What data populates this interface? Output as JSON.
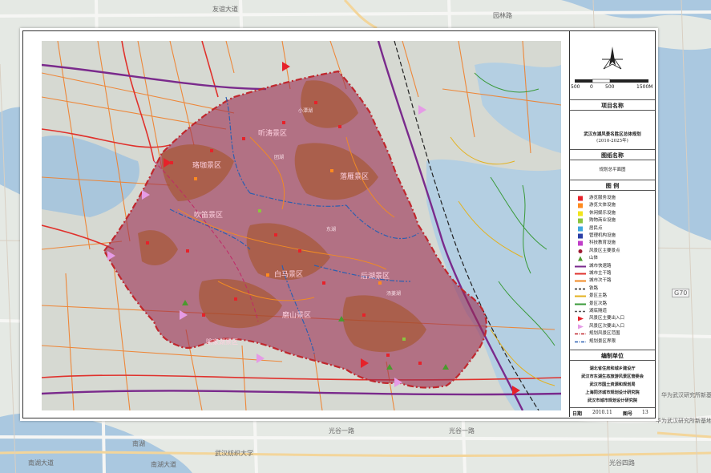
{
  "basemap": {
    "labels": [
      "友谊大道",
      "园林路",
      "华为武汉研究所新基地",
      "南湖",
      "南湖大道",
      "武汉纺织大学",
      "南湖大道",
      "光谷一路",
      "光谷一路",
      "光谷四路",
      "华为武汉研究所新基地",
      "G70"
    ]
  },
  "panel": {
    "scale": {
      "ticks": [
        "500",
        "0",
        "500",
        "1500M"
      ]
    },
    "project_label": "项目名称",
    "project_title": "武汉东湖风景名胜区总体规划",
    "project_period": "(2010-2025年)",
    "drawing_label": "图纸名称",
    "drawing_name": "规划总平面图",
    "legend_title": "图 例",
    "legend": [
      {
        "label": "游览服务设施",
        "type": "square",
        "color": "#e6222a"
      },
      {
        "label": "游览文体设施",
        "type": "square",
        "color": "#ff8a1f"
      },
      {
        "label": "休闲娱乐设施",
        "type": "square",
        "color": "#f2e51c"
      },
      {
        "label": "购物商业设施",
        "type": "square",
        "color": "#8bc53f"
      },
      {
        "label": "居民点",
        "type": "square",
        "color": "#3fa8e0"
      },
      {
        "label": "管理机构设施",
        "type": "square",
        "color": "#2b3fa6"
      },
      {
        "label": "科技教育设施",
        "type": "square",
        "color": "#c03ec8"
      },
      {
        "label": "风景区主要景点",
        "type": "dot",
        "color": "#9e1b32"
      },
      {
        "label": "山体",
        "type": "triangle",
        "color": "#4a9a2d"
      },
      {
        "label": "城市快速路",
        "type": "line",
        "color": "#7a2a8c"
      },
      {
        "label": "城市主干路",
        "type": "line",
        "color": "#e0312c"
      },
      {
        "label": "城市次干路",
        "type": "line",
        "color": "#f08a24"
      },
      {
        "label": "铁路",
        "type": "dash",
        "color": "#222222"
      },
      {
        "label": "景区主路",
        "type": "line",
        "color": "#e3b21f"
      },
      {
        "label": "景区次路",
        "type": "line",
        "color": "#3a9a3a"
      },
      {
        "label": "湖底隧道",
        "type": "dash",
        "color": "#555555"
      },
      {
        "label": "风景区主要出入口",
        "type": "flag",
        "color": "#e6222a"
      },
      {
        "label": "风景区次要出入口",
        "type": "flag",
        "color": "#e59be6"
      },
      {
        "label": "规划风景区范围",
        "type": "dashdot",
        "color": "#c0272d"
      },
      {
        "label": "规划景区界限",
        "type": "dashdot",
        "color": "#2b5fb0"
      }
    ],
    "org_label": "编制单位",
    "orgs": [
      "湖北省住房和城乡建设厅",
      "武汉市东湖生态旅游风景区管委会",
      "武汉市国土资源和规划局",
      "上海同济城市规划设计研究院",
      "武汉市城市规划设计研究院"
    ],
    "date_label": "日期",
    "date": "2010.11",
    "sheet_label": "图号",
    "sheet_no": "13"
  },
  "map": {
    "zone_labels": [
      "珞珈景区",
      "听涛景区",
      "落雁景区",
      "吹笛景区",
      "白马景区",
      "磨山景区",
      "喻家湖景区",
      "后湖景区"
    ],
    "place_labels": [
      "小潭湖",
      "东湖",
      "团湖",
      "汤菱湖"
    ]
  }
}
